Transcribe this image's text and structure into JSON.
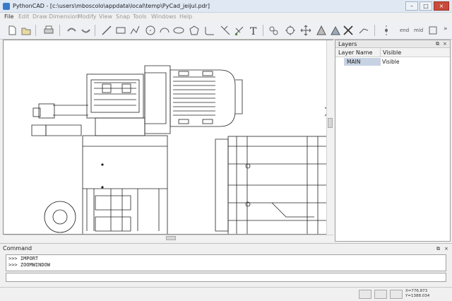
{
  "window": {
    "title": "PythonCAD - [c:\\users\\mboscolo\\appdata\\local\\temp\\PyCad_jeijul.pdr]",
    "minimize": "–",
    "maximize": "□",
    "close": "×"
  },
  "menu": [
    "File",
    "Edit",
    "Draw",
    "Dimension",
    "Modify",
    "View",
    "Snap",
    "Tools",
    "Windows",
    "Help"
  ],
  "toolbar": {
    "end_label": "end",
    "mid_label": "mid",
    "more_label": "»"
  },
  "layers": {
    "title": "Layers",
    "float_btn": "⧉",
    "close_btn": "×",
    "columns": [
      "Layer Name",
      "Visible"
    ],
    "rows": [
      {
        "name": "MAIN",
        "visible": "Visible"
      }
    ]
  },
  "command": {
    "title": "Command",
    "float_btn": "⧉",
    "close_btn": "×",
    "lines": [
      ">>> IMPORT",
      ">>> ZOOMWINDOW"
    ],
    "input_value": ""
  },
  "status": {
    "x": "X=776.873",
    "y": "Y=1388.034"
  },
  "colors": {
    "titlebar": "#dfe8f3",
    "selection": "#c7d3e3",
    "close": "#c94b3b"
  }
}
